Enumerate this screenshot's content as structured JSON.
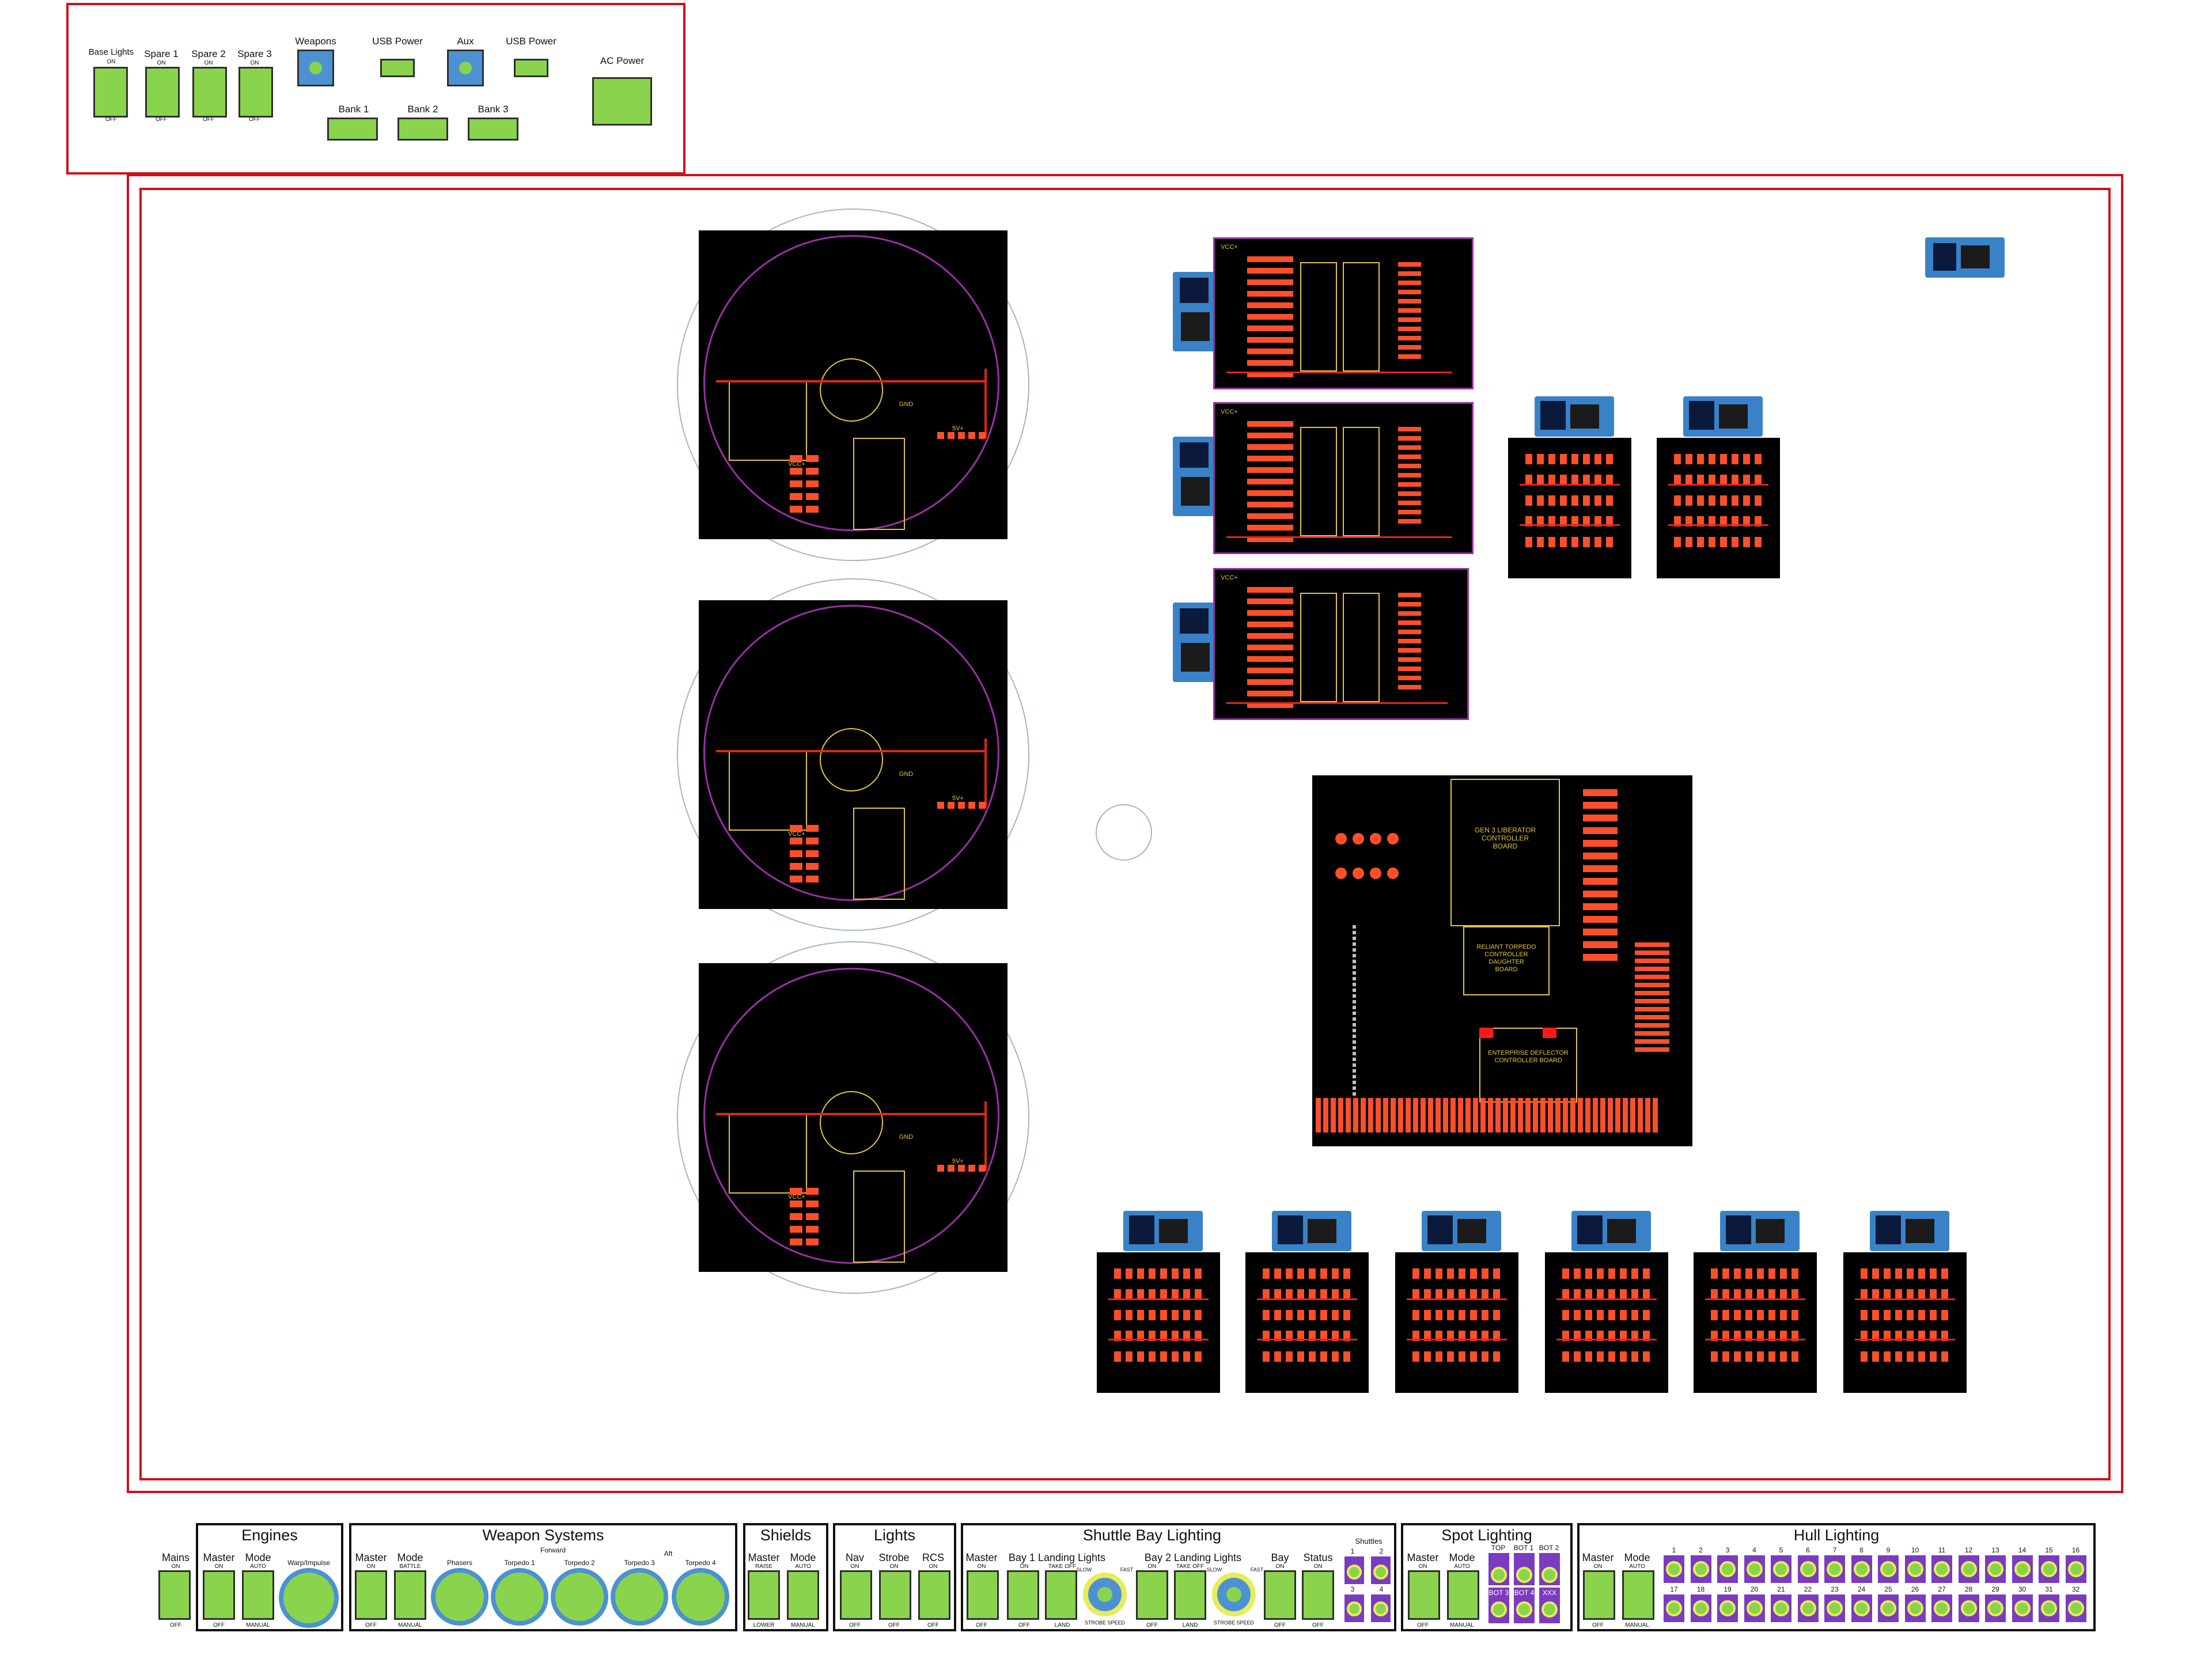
{
  "top_panel": {
    "switches": [
      {
        "label": "Base Lights",
        "on": "ON",
        "off": "OFF"
      },
      {
        "label": "Spare 1",
        "on": "ON",
        "off": "OFF"
      },
      {
        "label": "Spare 2",
        "on": "ON",
        "off": "OFF"
      },
      {
        "label": "Spare 3",
        "on": "ON",
        "off": "OFF"
      }
    ],
    "weapons": "Weapons",
    "usb1": "USB Power",
    "aux": "Aux",
    "usb2": "USB Power",
    "bank1": "Bank 1",
    "bank2": "Bank 2",
    "bank3": "Bank 3",
    "ac": "AC Power"
  },
  "boards": {
    "round_labels": [
      "VCC+",
      "GND",
      "5V+"
    ],
    "main_board": {
      "title1": "GEN 3 LIBERATOR",
      "title2": "CONTROLLER",
      "title3": "BOARD",
      "title4": "RELIANT TORPEDO",
      "title5": "CONTROLLER",
      "title6": "DAUGHTER",
      "title7": "BOARD",
      "title8": "ENTERPRISE DEFLECTOR",
      "title9": "CONTROLLER BOARD"
    },
    "rect_label": "VCC+"
  },
  "controls": {
    "mains": {
      "label": "Mains",
      "on": "ON",
      "off": "OFF"
    },
    "engines": {
      "title": "Engines",
      "master": "Master",
      "mode": "Mode",
      "warp": "Warp/Impulse",
      "on": "ON",
      "off": "OFF",
      "auto": "AUTO",
      "manual": "MANUAL"
    },
    "weapons": {
      "title": "Weapon Systems",
      "master": "Master",
      "mode": "Mode",
      "forward": "Forward",
      "aft": "Aft",
      "phasers": "Phasers",
      "t1": "Torpedo 1",
      "t2": "Torpedo 2",
      "t3": "Torpedo 3",
      "t4": "Torpedo 4",
      "on": "ON",
      "off": "OFF",
      "battle": "BATTLE",
      "manual": "MANUAL"
    },
    "shields": {
      "title": "Shields",
      "master": "Master",
      "mode": "Mode",
      "raise": "RAISE",
      "lower": "LOWER",
      "auto": "AUTO",
      "manual": "MANUAL"
    },
    "lights": {
      "title": "Lights",
      "nav": "Nav",
      "strobe": "Strobe",
      "rcs": "RCS",
      "on": "ON",
      "off": "OFF"
    },
    "shuttle": {
      "title": "Shuttle Bay Lighting",
      "master": "Master",
      "bay1": "Bay 1 Landing Lights",
      "bay2": "Bay 2 Landing Lights",
      "bay": "Bay",
      "status": "Status",
      "takeoff": "TAKE OFF",
      "land": "LAND",
      "slow": "SLOW",
      "fast": "FAST",
      "strobe_speed": "STROBE SPEED",
      "on": "ON",
      "off": "OFF",
      "shuttles": "Shuttles",
      "s1": "1",
      "s2": "2",
      "s3": "3",
      "s4": "4"
    },
    "spot": {
      "title": "Spot Lighting",
      "master": "Master",
      "mode": "Mode",
      "top": "TOP",
      "bot1": "BOT 1",
      "bot2": "BOT 2",
      "bot3": "BOT 3",
      "bot4": "BOT 4",
      "xxx": "XXX",
      "on": "ON",
      "off": "OFF",
      "auto": "AUTO",
      "manual": "MANUAL"
    },
    "hull": {
      "title": "Hull Lighting",
      "master": "Master",
      "mode": "Mode",
      "on": "ON",
      "off": "OFF",
      "auto": "AUTO",
      "manual": "MANUAL",
      "numbers": [
        "1",
        "2",
        "3",
        "4",
        "5",
        "6",
        "7",
        "8",
        "9",
        "10",
        "11",
        "12",
        "13",
        "14",
        "15",
        "16",
        "17",
        "18",
        "19",
        "20",
        "21",
        "22",
        "23",
        "24",
        "25",
        "26",
        "27",
        "28",
        "29",
        "30",
        "31",
        "32"
      ]
    }
  },
  "colors": {
    "accent_red": "#d0101a",
    "switch_green": "#8ad44d",
    "button_blue": "#4c92d2",
    "pcb_black": "#000000",
    "purple": "#7a3bc1"
  }
}
